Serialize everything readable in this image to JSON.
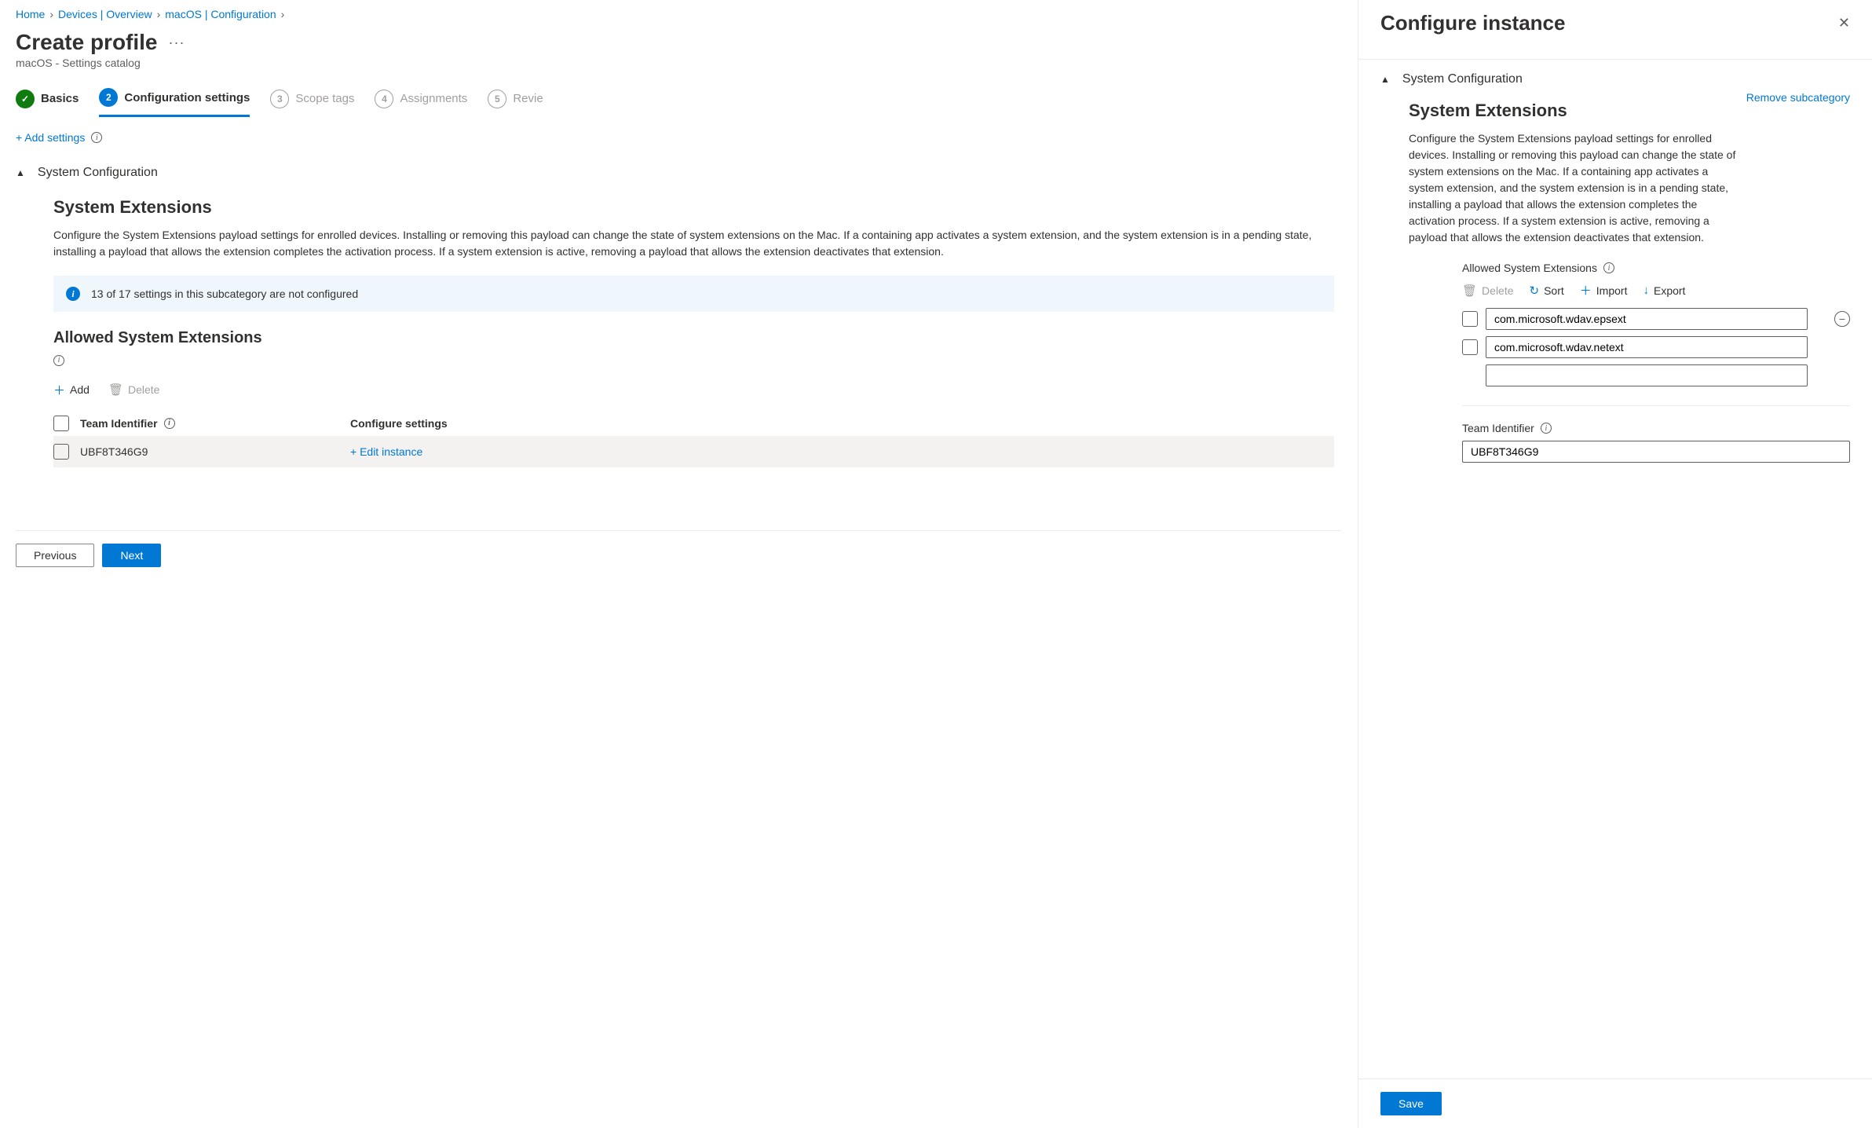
{
  "breadcrumb": {
    "home": "Home",
    "devices": "Devices | Overview",
    "macos": "macOS | Configuration"
  },
  "page": {
    "title": "Create profile",
    "subtitle": "macOS - Settings catalog"
  },
  "wizard": {
    "step1": "Basics",
    "step2": "Configuration settings",
    "step3": "Scope tags",
    "step4": "Assignments",
    "step5": "Revie"
  },
  "add_settings": "+ Add settings",
  "section": {
    "system_config": "System Configuration",
    "system_ext_title": "System Extensions",
    "system_ext_desc": "Configure the System Extensions payload settings for enrolled devices. Installing or removing this payload can change the state of system extensions on the Mac. If a containing app activates a system extension, and the system extension is in a pending state, installing a payload that allows the extension completes the activation process. If a system extension is active, removing a payload that allows the extension deactivates that extension."
  },
  "banner": {
    "text": "13 of 17 settings in this subcategory are not configured"
  },
  "allowed": {
    "title": "Allowed System Extensions",
    "add": "Add",
    "delete": "Delete"
  },
  "table": {
    "col_team": "Team Identifier",
    "col_config": "Configure settings",
    "row_team": "UBF8T346G9",
    "row_edit": "+ Edit instance"
  },
  "footer": {
    "prev": "Previous",
    "next": "Next"
  },
  "panel": {
    "title": "Configure instance",
    "remove_sub": "Remove subcategory",
    "allowed_label": "Allowed System Extensions",
    "toolbar": {
      "delete": "Delete",
      "sort": "Sort",
      "import": "Import",
      "export": "Export"
    },
    "ext1": "com.microsoft.wdav.epsext",
    "ext2": "com.microsoft.wdav.netext",
    "team_label": "Team Identifier",
    "team_value": "UBF8T346G9",
    "save": "Save"
  }
}
